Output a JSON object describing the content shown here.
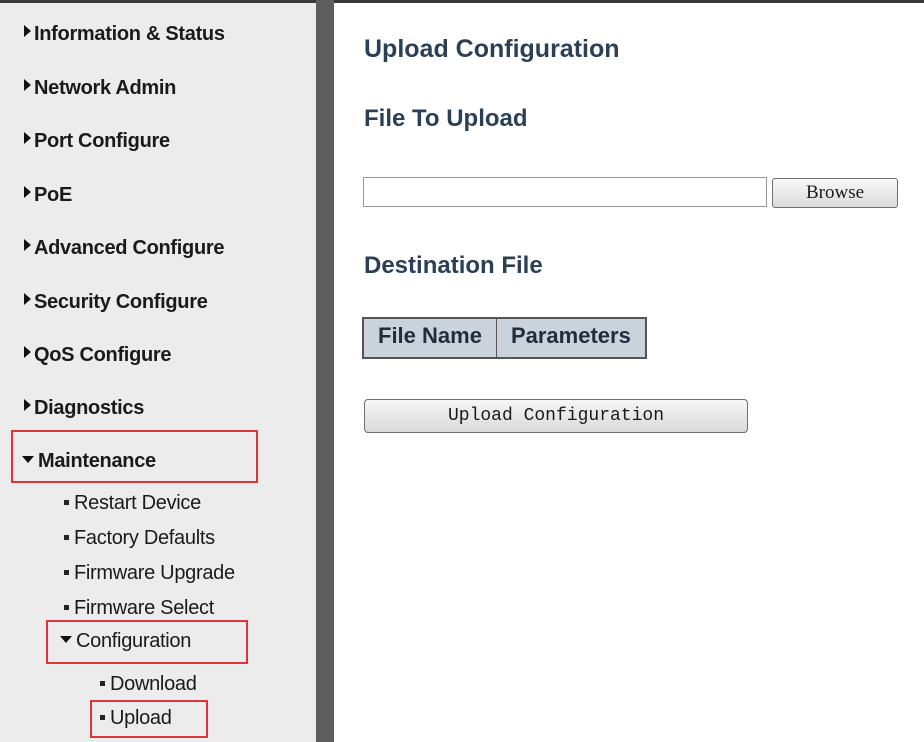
{
  "sidebar": {
    "items": [
      {
        "label": "Information & Status"
      },
      {
        "label": "Network Admin"
      },
      {
        "label": "Port Configure"
      },
      {
        "label": "PoE"
      },
      {
        "label": "Advanced Configure"
      },
      {
        "label": "Security Configure"
      },
      {
        "label": "QoS Configure"
      },
      {
        "label": "Diagnostics"
      },
      {
        "label": "Maintenance"
      }
    ],
    "maintenance_sub": [
      {
        "label": "Restart Device"
      },
      {
        "label": "Factory Defaults"
      },
      {
        "label": "Firmware Upgrade"
      },
      {
        "label": "Firmware Select"
      },
      {
        "label": "Configuration"
      }
    ],
    "configuration_sub": [
      {
        "label": "Download"
      },
      {
        "label": "Upload"
      }
    ]
  },
  "main": {
    "title": "Upload Configuration",
    "file_to_upload_heading": "File To Upload",
    "file_input_value": "",
    "browse_label": "Browse",
    "destination_heading": "Destination File",
    "table_headers": [
      "File Name",
      "Parameters"
    ],
    "upload_button_label": "Upload Configuration"
  },
  "colors": {
    "heading": "#2b3f56",
    "sidebar_bg": "#ececec",
    "splitter": "#5e5e5e",
    "highlight": "#e0333a",
    "table_header_bg": "#cad2dc"
  }
}
